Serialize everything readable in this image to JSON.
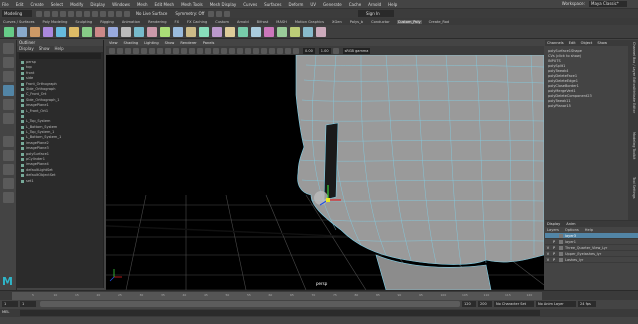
{
  "menubar": {
    "items": [
      "File",
      "Edit",
      "Create",
      "Select",
      "Modify",
      "Display",
      "Windows",
      "Mesh",
      "Edit Mesh",
      "Mesh Tools",
      "Mesh Display",
      "Curves",
      "Surfaces",
      "Deform",
      "UV",
      "Generate",
      "Cache",
      "Arnold",
      "Help"
    ],
    "workspace_label": "Workspace:",
    "workspace_value": "Maya Classic*"
  },
  "modebar": {
    "mode": "Modeling",
    "no_live_surface": "No Live Surface",
    "symmetry": "Symmetry: Off",
    "sign_in": "Sign In"
  },
  "shelf_tabs": [
    "Curves / Surfaces",
    "Poly Modeling",
    "Sculpting",
    "Rigging",
    "Animation",
    "Rendering",
    "FX",
    "FX Caching",
    "Custom",
    "Arnold",
    "Bifrost",
    "MASH",
    "Motion Graphics",
    "XGen",
    "Polys_b",
    "Conductor",
    "Custom_Poly",
    "Create_Rod"
  ],
  "shelf_active_index": 16,
  "outliner": {
    "title": "Outliner",
    "menu": [
      "Display",
      "Show",
      "Help"
    ],
    "items": [
      "persp",
      "top",
      "front",
      "side",
      "Front_Orthograph",
      "Side_Orthograph",
      "C_Front_Ort",
      "Side_Orthograph_1",
      "imagePlane1",
      "L_Front_Ort1",
      "",
      "L_Top_System",
      "L_Bottom_System",
      "L_Top_System_1",
      "L_Bottom_System_1",
      "imagePlane2",
      "imagePlane3",
      "polySurface1",
      "pCylinder1",
      "imagePlane4",
      "defaultLightSet",
      "defaultObjectSet",
      "set1"
    ]
  },
  "viewport": {
    "menu": [
      "View",
      "Shading",
      "Lighting",
      "Show",
      "Renderer",
      "Panels"
    ],
    "near": "0.00",
    "far": "1.00",
    "colorspace": "sRGB gamma",
    "camera_label": "persp"
  },
  "channelbox": {
    "tabs": [
      "Channels",
      "Edit",
      "Object",
      "Show"
    ],
    "items": [
      "polySurface1Shape",
      "CVs (click to show)",
      "INPUTS",
      "polySplit1",
      "polyTweak4",
      "polyDeleteFace1",
      "polyDeleteEdge1",
      "polyCloseBorder1",
      "polyMergeVert1",
      "polyDeleteComponent23",
      "polyTweak11",
      "polyPlanar15"
    ]
  },
  "side_tabs": [
    "Channel Box / Layer Editor",
    "Attribute Editor",
    "Modeling Toolkit",
    "Tool Settings"
  ],
  "layers": {
    "tabs": [
      "Display",
      "Anim"
    ],
    "menu": [
      "Layers",
      "Options",
      "Help"
    ],
    "rows": [
      {
        "name": "layer3",
        "v": "",
        "p": ""
      },
      {
        "name": "layer1",
        "v": "",
        "p": "P"
      },
      {
        "name": "Three_Quarter_View_Lyr",
        "v": "V",
        "p": "P"
      },
      {
        "name": "Upper_Eyelashes_lyr",
        "v": "V",
        "p": "P"
      },
      {
        "name": "Lashes_lyr",
        "v": "V",
        "p": "P"
      }
    ]
  },
  "timeline": {
    "ticks": [
      "5",
      "10",
      "15",
      "20",
      "25",
      "30",
      "35",
      "40",
      "45",
      "50",
      "55",
      "60",
      "65",
      "70",
      "75",
      "80",
      "85",
      "90",
      "95",
      "100",
      "105",
      "110",
      "115",
      "120"
    ],
    "current_frame": "1"
  },
  "range": {
    "start": "1",
    "start2": "1",
    "end": "120",
    "end2": "120",
    "end3": "200",
    "character": "No Character Set",
    "anim_layer": "No Anim Layer",
    "fps": "24 fps"
  },
  "cmdline": {
    "label": "MEL"
  },
  "colors": {
    "selection": "#5285a6",
    "wire": "#7fd0e8",
    "mesh": "#9a9a9a"
  }
}
